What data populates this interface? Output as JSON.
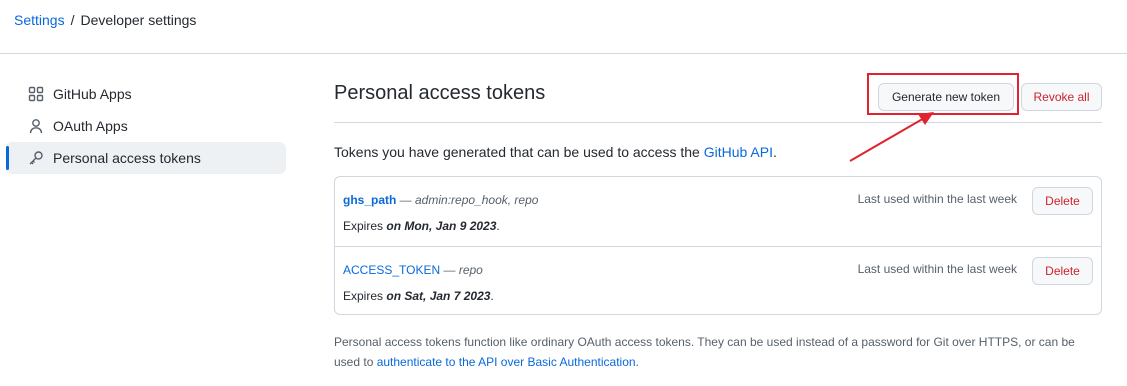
{
  "breadcrumb": {
    "settings": "Settings",
    "separator": "/",
    "current": "Developer settings"
  },
  "sidebar": {
    "items": [
      {
        "label": "GitHub Apps",
        "icon": "apps-grid-icon",
        "active": false
      },
      {
        "label": "OAuth Apps",
        "icon": "person-icon",
        "active": false
      },
      {
        "label": "Personal access tokens",
        "icon": "key-icon",
        "active": true
      }
    ]
  },
  "main": {
    "title": "Personal access tokens",
    "generate_label": "Generate new token",
    "revoke_label": "Revoke all",
    "intro_text": "Tokens you have generated that can be used to access the ",
    "intro_link": "GitHub API",
    "intro_end": "."
  },
  "tokens": [
    {
      "name": "ghs_path",
      "scopes": " — admin:repo_hook, repo",
      "expires_prefix": "Expires ",
      "expires_on": "on Mon, Jan 9 2023",
      "expires_suffix": ".",
      "last_used": "Last used within the last week",
      "delete_label": "Delete"
    },
    {
      "name": "ACCESS_TOKEN",
      "scopes": " — repo",
      "expires_prefix": "Expires ",
      "expires_on": "on Sat, Jan 7 2023",
      "expires_suffix": ".",
      "last_used": "Last used within the last week",
      "delete_label": "Delete"
    }
  ],
  "footer": {
    "text": "Personal access tokens function like ordinary OAuth access tokens. They can be used instead of a password for Git over HTTPS, or can be used to ",
    "link": "authenticate to the API over Basic Authentication",
    "end": "."
  },
  "colors": {
    "link": "#0969da",
    "danger": "#cf222e",
    "annotation": "#e0232e"
  }
}
